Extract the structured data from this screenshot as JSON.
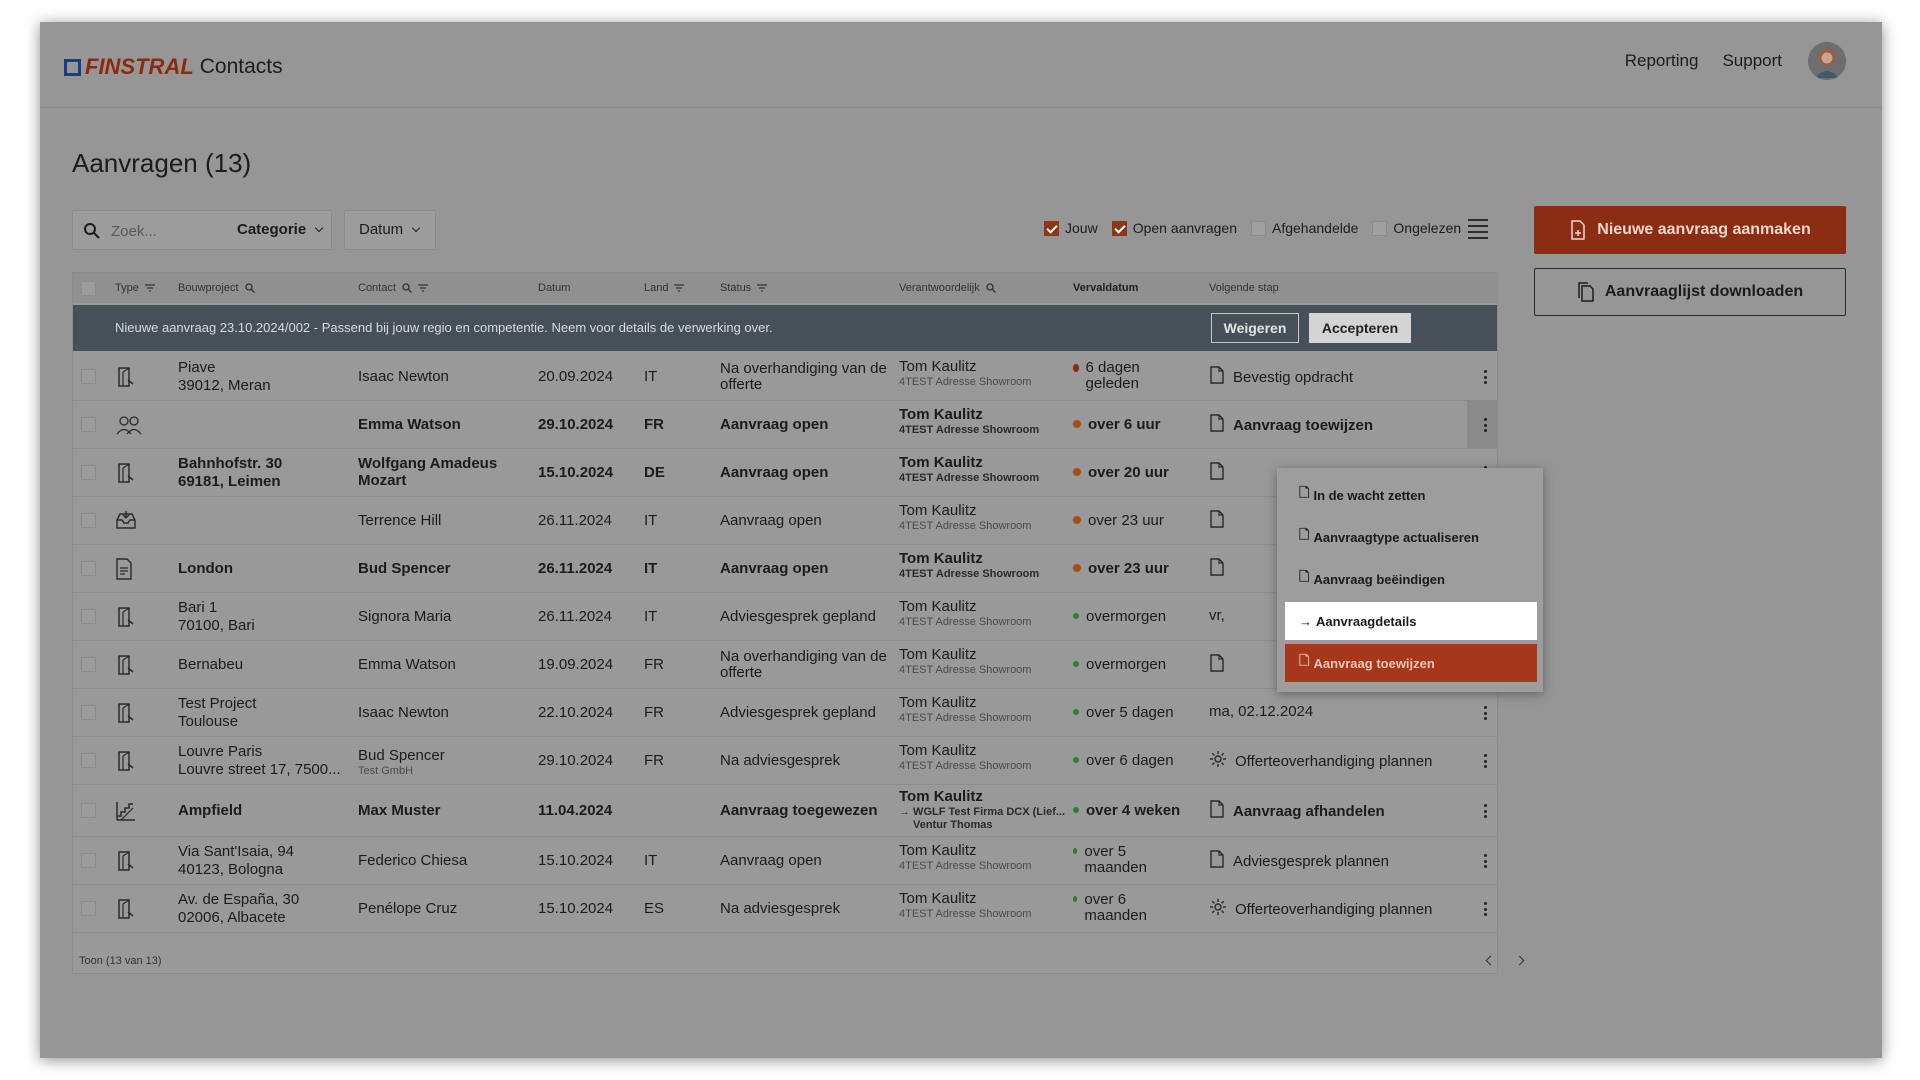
{
  "header": {
    "logo_brand": "FINSTRAL",
    "logo_product": "Contacts",
    "nav": [
      "Reporting",
      "Support"
    ]
  },
  "page": {
    "title": "Aanvragen (13)"
  },
  "filters": {
    "search_placeholder": "Zoek...",
    "category_label": "Categorie",
    "date_label": "Datum",
    "checkboxes": [
      {
        "label": "Jouw",
        "checked": true
      },
      {
        "label": "Open aanvragen",
        "checked": true
      },
      {
        "label": "Afgehandelde",
        "checked": false
      },
      {
        "label": "Ongelezen",
        "checked": false
      }
    ]
  },
  "actions": {
    "new_request": "Nieuwe aanvraag aanmaken",
    "download_list": "Aanvraaglijst downloaden"
  },
  "table": {
    "columns": [
      "Type",
      "Bouwproject",
      "Contact",
      "Datum",
      "Land",
      "Status",
      "Verantwoordelijk",
      "Vervaldatum",
      "Volgende stap"
    ],
    "banner": {
      "text": "Nieuwe aanvraag 23.10.2024/002 - Passend bij jouw regio en competentie. Neem voor details de verwerking over.",
      "reject": "Weigeren",
      "accept": "Accepteren"
    },
    "rows": [
      {
        "bold": false,
        "type_icon": "door-icon",
        "project1": "Piave",
        "project2": "39012, Meran",
        "contact": "Isaac Newton",
        "contact_sub": "",
        "date": "20.09.2024",
        "country": "IT",
        "status": "Na overhandiging van de offerte",
        "resp": "Tom Kaulitz",
        "resp_sub": "4TEST Adresse Showroom",
        "resp_sub2": "",
        "due": "6 dagen geleden",
        "due_color": "red",
        "next": "Bevestig opdracht",
        "next_icon": "doc-icon"
      },
      {
        "bold": true,
        "type_icon": "people-icon",
        "project1": "",
        "project2": "",
        "contact": "Emma Watson",
        "contact_sub": "",
        "date": "29.10.2024",
        "country": "FR",
        "status": "Aanvraag open",
        "resp": "Tom Kaulitz",
        "resp_sub": "4TEST Adresse Showroom",
        "resp_sub2": "",
        "due": "over 6 uur",
        "due_color": "orange",
        "next": "Aanvraag toewijzen",
        "next_icon": "doc-icon"
      },
      {
        "bold": true,
        "type_icon": "door-icon",
        "project1": "Bahnhofstr. 30",
        "project2": "69181, Leimen",
        "contact": "Wolfgang Amadeus Mozart",
        "contact_sub": "",
        "date": "15.10.2024",
        "country": "DE",
        "status": "Aanvraag open",
        "resp": "Tom Kaulitz",
        "resp_sub": "4TEST Adresse Showroom",
        "resp_sub2": "",
        "due": "over 20 uur",
        "due_color": "orange",
        "next": "",
        "next_icon": "doc-icon"
      },
      {
        "bold": false,
        "type_icon": "inbox-icon",
        "project1": "",
        "project2": "",
        "contact": "Terrence Hill",
        "contact_sub": "",
        "date": "26.11.2024",
        "country": "IT",
        "status": "Aanvraag open",
        "resp": "Tom Kaulitz",
        "resp_sub": "4TEST Adresse Showroom",
        "resp_sub2": "",
        "due": "over 23 uur",
        "due_color": "orange",
        "next": "",
        "next_icon": "doc-icon"
      },
      {
        "bold": true,
        "type_icon": "file-icon",
        "project1": "London",
        "project2": "",
        "contact": "Bud Spencer",
        "contact_sub": "",
        "date": "26.11.2024",
        "country": "IT",
        "status": "Aanvraag open",
        "resp": "Tom Kaulitz",
        "resp_sub": "4TEST Adresse Showroom",
        "resp_sub2": "",
        "due": "over 23 uur",
        "due_color": "orange",
        "next": "",
        "next_icon": "doc-icon"
      },
      {
        "bold": false,
        "type_icon": "door-icon",
        "project1": "Bari 1",
        "project2": "70100, Bari",
        "contact": "Signora Maria",
        "contact_sub": "",
        "date": "26.11.2024",
        "country": "IT",
        "status": "Adviesgesprek gepland",
        "resp": "Tom Kaulitz",
        "resp_sub": "4TEST Adresse Showroom",
        "resp_sub2": "",
        "due": "overmorgen",
        "due_color": "green",
        "next": "vr,",
        "next_icon": ""
      },
      {
        "bold": false,
        "type_icon": "door-icon",
        "project1": "Bernabeu",
        "project2": "",
        "contact": "Emma Watson",
        "contact_sub": "",
        "date": "19.09.2024",
        "country": "FR",
        "status": "Na overhandiging van de offerte",
        "resp": "Tom Kaulitz",
        "resp_sub": "4TEST Adresse Showroom",
        "resp_sub2": "",
        "due": "overmorgen",
        "due_color": "green",
        "next": "",
        "next_icon": "doc-icon"
      },
      {
        "bold": false,
        "type_icon": "door-icon",
        "project1": "Test Project",
        "project2": "Toulouse",
        "contact": "Isaac Newton",
        "contact_sub": "",
        "date": "22.10.2024",
        "country": "FR",
        "status": "Adviesgesprek gepland",
        "resp": "Tom Kaulitz",
        "resp_sub": "4TEST Adresse Showroom",
        "resp_sub2": "",
        "due": "over 5 dagen",
        "due_color": "green",
        "next": "ma, 02.12.2024",
        "next_icon": ""
      },
      {
        "bold": false,
        "type_icon": "door-icon",
        "project1": "Louvre Paris",
        "project2": "Louvre street 17, 7500...",
        "contact": "Bud Spencer",
        "contact_sub": "Test GmbH",
        "date": "29.10.2024",
        "country": "FR",
        "status": "Na adviesgesprek",
        "resp": "Tom Kaulitz",
        "resp_sub": "4TEST Adresse Showroom",
        "resp_sub2": "",
        "due": "over 6 dagen",
        "due_color": "green",
        "next": "Offerteoverhandiging plannen",
        "next_icon": "gear-icon"
      },
      {
        "bold": true,
        "type_icon": "stairs-icon",
        "project1": "Ampfield",
        "project2": "",
        "contact": "Max Muster",
        "contact_sub": "",
        "date": "11.04.2024",
        "country": "",
        "status": "Aanvraag toegewezen",
        "resp": "Tom Kaulitz",
        "resp_sub": "→ WGLF Test Firma DCX (Lief...",
        "resp_sub2": "Ventur Thomas",
        "due": "over 4 weken",
        "due_color": "green",
        "next": "Aanvraag afhandelen",
        "next_icon": "doc-icon"
      },
      {
        "bold": false,
        "type_icon": "door-icon",
        "project1": "Via Sant'Isaia, 94",
        "project2": "40123, Bologna",
        "contact": "Federico Chiesa",
        "contact_sub": "",
        "date": "15.10.2024",
        "country": "IT",
        "status": "Aanvraag open",
        "resp": "Tom Kaulitz",
        "resp_sub": "4TEST Adresse Showroom",
        "resp_sub2": "",
        "due": "over 5 maanden",
        "due_color": "green",
        "next": "Adviesgesprek plannen",
        "next_icon": "doc-icon"
      },
      {
        "bold": false,
        "type_icon": "door-icon",
        "project1": "Av. de España, 30",
        "project2": "02006, Albacete",
        "contact": "Penélope Cruz",
        "contact_sub": "",
        "date": "15.10.2024",
        "country": "ES",
        "status": "Na adviesgesprek",
        "resp": "Tom Kaulitz",
        "resp_sub": "4TEST Adresse Showroom",
        "resp_sub2": "",
        "due": "over 6 maanden",
        "due_color": "green",
        "next": "Offerteoverhandiging plannen",
        "next_icon": "gear-icon"
      }
    ],
    "footer": "Toon  (13 van 13)"
  },
  "context_menu": {
    "items": [
      {
        "label": "In de wacht zetten",
        "icon": "doc-icon"
      },
      {
        "label": "Aanvraagtype actualiseren",
        "icon": "doc-icon"
      },
      {
        "label": "Aanvraag beëindigen",
        "icon": "doc-icon"
      },
      {
        "label": "Aanvraagdetails",
        "icon": "arrow-right-icon"
      },
      {
        "label": "Aanvraag toewijzen",
        "icon": "doc-icon"
      }
    ]
  },
  "colors": {
    "accent": "#8b2d12",
    "overlay": "#969696",
    "banner": "#475058"
  }
}
